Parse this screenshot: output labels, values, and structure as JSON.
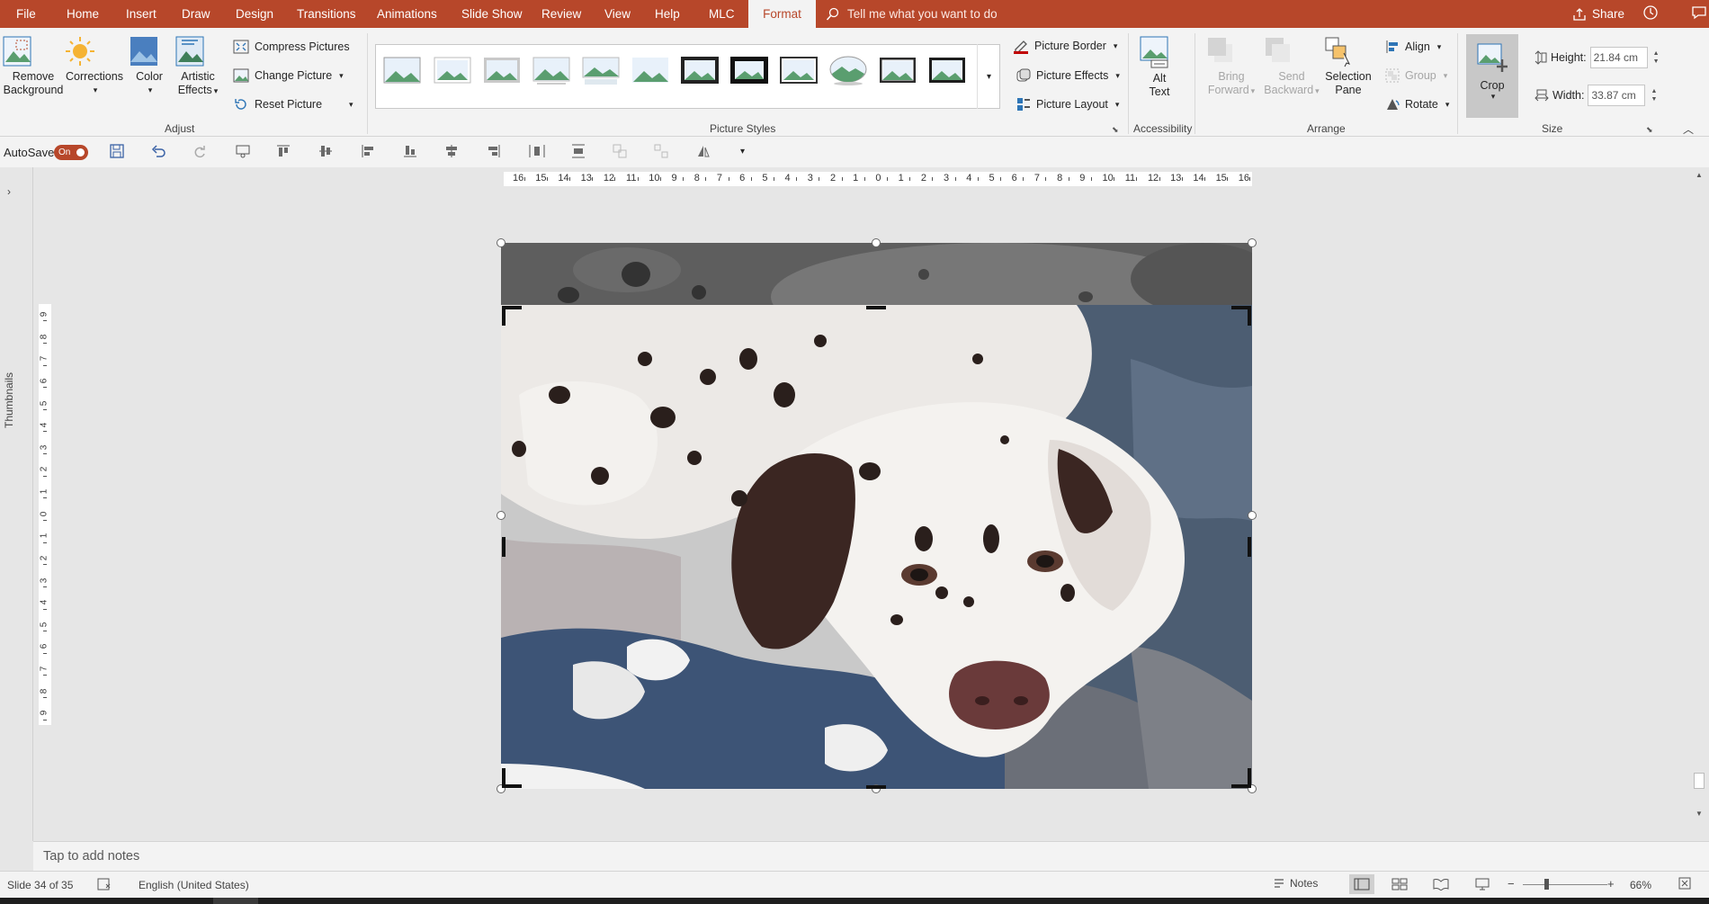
{
  "tabs": [
    {
      "label": "File",
      "active": false
    },
    {
      "label": "Home",
      "active": false
    },
    {
      "label": "Insert",
      "active": false
    },
    {
      "label": "Draw",
      "active": false
    },
    {
      "label": "Design",
      "active": false
    },
    {
      "label": "Transitions",
      "active": false
    },
    {
      "label": "Animations",
      "active": false
    },
    {
      "label": "Slide Show",
      "active": false
    },
    {
      "label": "Review",
      "active": false
    },
    {
      "label": "View",
      "active": false
    },
    {
      "label": "Help",
      "active": false
    },
    {
      "label": "MLC",
      "active": false
    },
    {
      "label": "Format",
      "active": true
    }
  ],
  "tellme": {
    "placeholder": "Tell me what you want to do"
  },
  "share": {
    "label": "Share"
  },
  "ribbon": {
    "adjust": {
      "group_label": "Adjust",
      "remove_background_1": "Remove",
      "remove_background_2": "Background",
      "corrections": "Corrections",
      "color": "Color",
      "artistic_effects_1": "Artistic",
      "artistic_effects_2": "Effects",
      "compress": "Compress Pictures",
      "change": "Change Picture",
      "reset": "Reset Picture"
    },
    "picture_styles": {
      "group_label": "Picture Styles",
      "border": "Picture Border",
      "effects": "Picture Effects",
      "layout": "Picture Layout"
    },
    "accessibility": {
      "group_label": "Accessibility",
      "alt_text_1": "Alt",
      "alt_text_2": "Text"
    },
    "arrange": {
      "group_label": "Arrange",
      "bring_forward_1": "Bring",
      "bring_forward_2": "Forward",
      "send_backward_1": "Send",
      "send_backward_2": "Backward",
      "selection_pane_1": "Selection",
      "selection_pane_2": "Pane",
      "align": "Align",
      "group": "Group",
      "rotate": "Rotate"
    },
    "size": {
      "group_label": "Size",
      "crop": "Crop",
      "height_label": "Height:",
      "height_value": "21.84 cm",
      "width_label": "Width:",
      "width_value": "33.87 cm"
    }
  },
  "qat": {
    "autosave_label": "AutoSave",
    "autosave_state": "On"
  },
  "thumbnails_label": "Thumbnails",
  "ruler": {
    "h_ticks": [
      "16",
      "15",
      "14",
      "13",
      "12",
      "11",
      "10",
      "9",
      "8",
      "7",
      "6",
      "5",
      "4",
      "3",
      "2",
      "1",
      "0",
      "1",
      "2",
      "3",
      "4",
      "5",
      "6",
      "7",
      "8",
      "9",
      "10",
      "11",
      "12",
      "13",
      "14",
      "15",
      "16"
    ],
    "v_ticks": [
      "9",
      "8",
      "7",
      "6",
      "5",
      "4",
      "3",
      "2",
      "1",
      "0",
      "1",
      "2",
      "3",
      "4",
      "5",
      "6",
      "7",
      "8",
      "9"
    ]
  },
  "notes": {
    "placeholder": "Tap to add notes"
  },
  "status": {
    "slide": "Slide 34 of 35",
    "language": "English (United States)",
    "notes": "Notes",
    "zoom": "66%"
  },
  "colors": {
    "accent": "#b7472a",
    "ribbon_bg": "#f3f3f3",
    "canvas_bg": "#e6e6e6"
  }
}
